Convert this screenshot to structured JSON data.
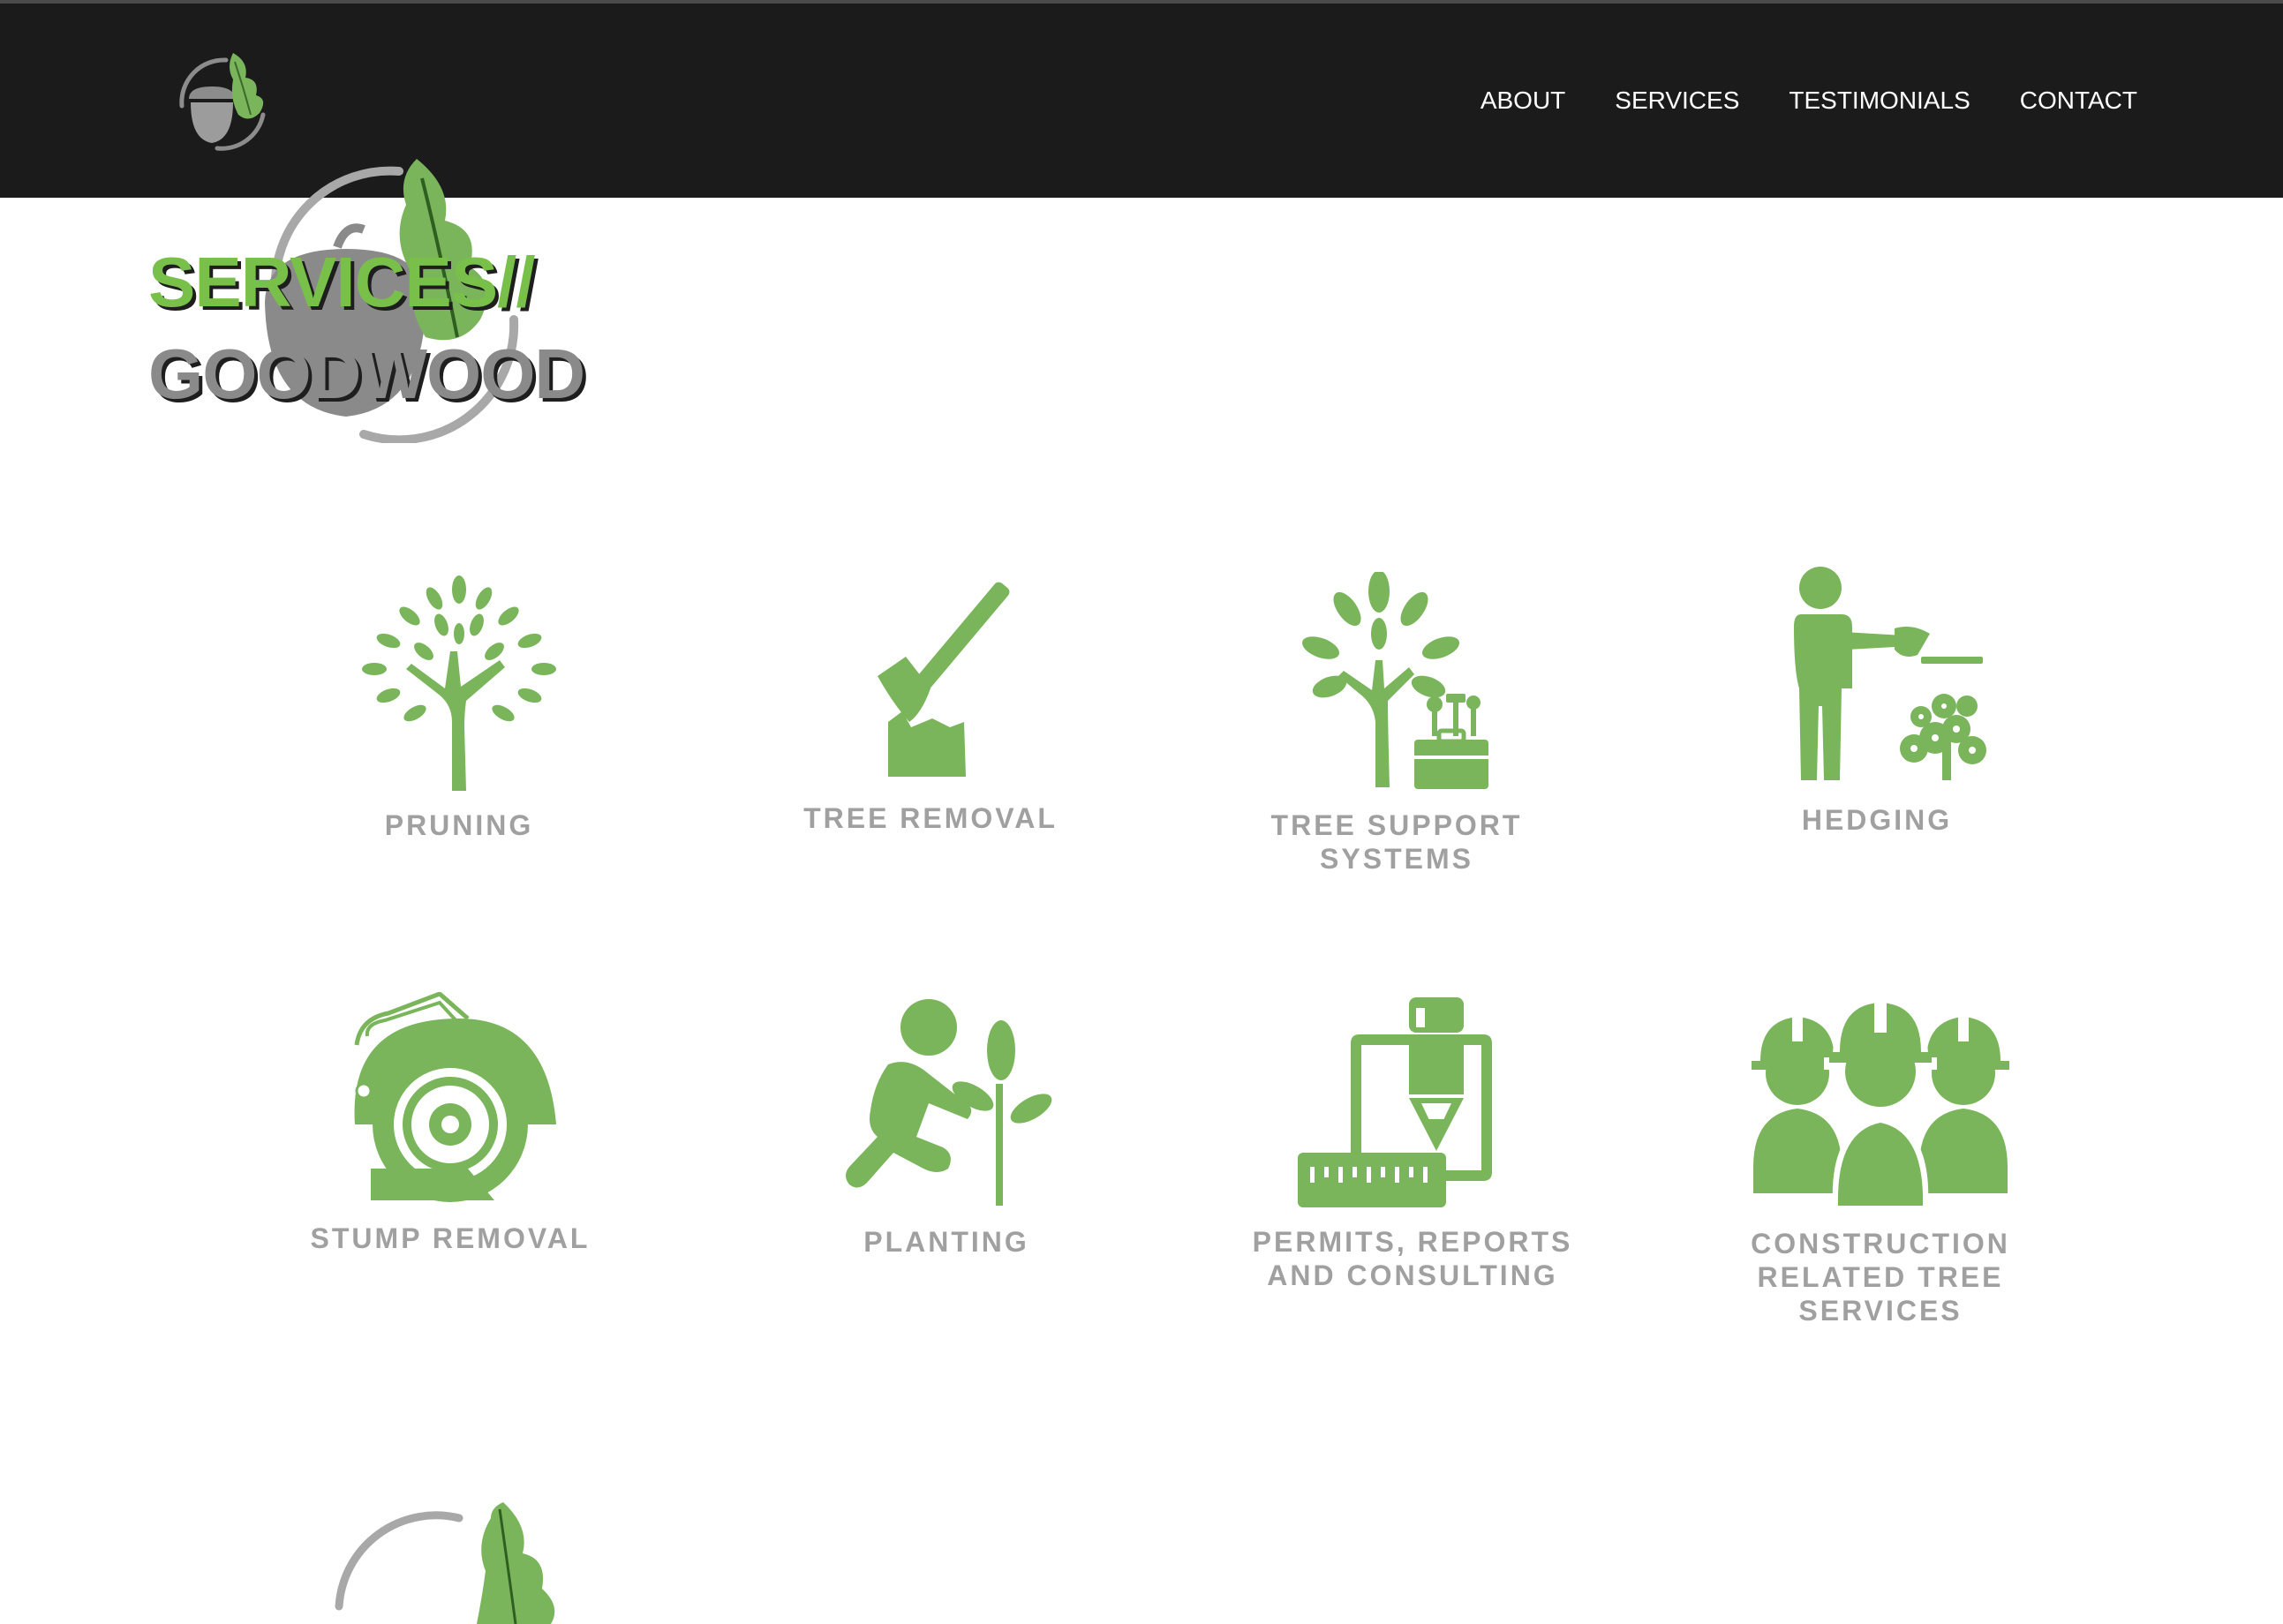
{
  "nav": {
    "links": [
      {
        "label": "ABOUT"
      },
      {
        "label": "SERVICES"
      },
      {
        "label": "TESTIMONIALS"
      },
      {
        "label": "CONTACT"
      }
    ]
  },
  "hero": {
    "title_line1": "SERVICES//",
    "title_line2": "GOODWOOD"
  },
  "services": [
    {
      "label": "PRUNING",
      "icon": "tree-icon"
    },
    {
      "label": "TREE REMOVAL",
      "icon": "axe-stump-icon"
    },
    {
      "label": "TREE SUPPORT SYSTEMS",
      "icon": "tree-toolbox-icon"
    },
    {
      "label": "HEDGING",
      "icon": "hedge-trimmer-icon"
    },
    {
      "label": "STUMP REMOVAL",
      "icon": "stump-grinder-icon"
    },
    {
      "label": "PLANTING",
      "icon": "planting-person-icon"
    },
    {
      "label": "PERMITS, REPORTS AND CONSULTING",
      "icon": "pen-ruler-icon"
    },
    {
      "label": "CONSTRUCTION RELATED TREE SERVICES",
      "icon": "workers-hardhat-icon"
    }
  ],
  "colors": {
    "brand_green": "#7ab55c",
    "title_green": "#78c04a",
    "label_grey": "#a0a0a0",
    "nav_bg": "#1b1b1b"
  }
}
